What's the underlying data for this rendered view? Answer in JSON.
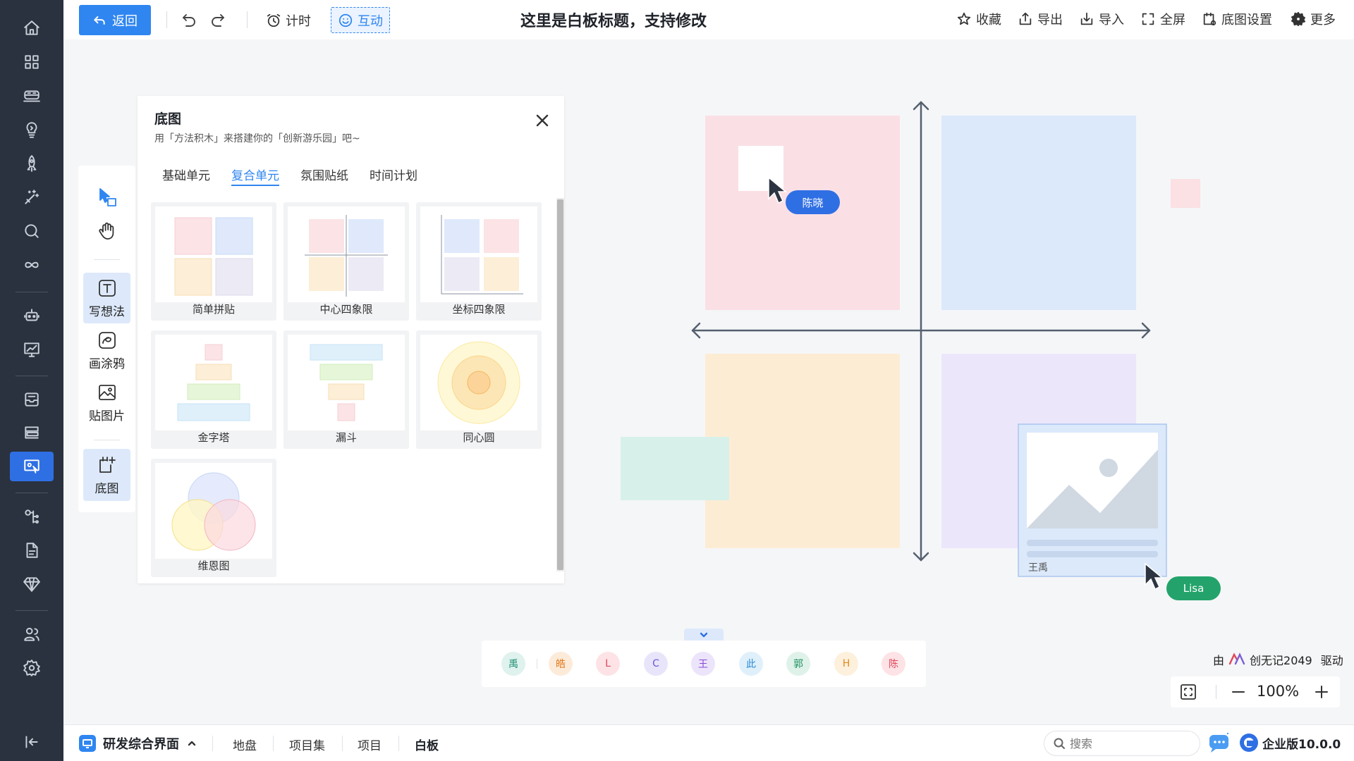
{
  "rail": {
    "items": [
      {
        "name": "home",
        "icon": "home-icon"
      },
      {
        "name": "apps",
        "icon": "grid-icon"
      },
      {
        "name": "train",
        "icon": "train-icon"
      },
      {
        "name": "idea",
        "icon": "lightbulb-icon"
      },
      {
        "name": "launch",
        "icon": "rocket-icon"
      },
      {
        "name": "magic",
        "icon": "magic-wand-icon"
      },
      {
        "name": "search",
        "icon": "search-icon"
      },
      {
        "name": "loop",
        "icon": "infinity-icon"
      },
      {
        "name": "robot",
        "icon": "robot-icon"
      },
      {
        "name": "dashboard",
        "icon": "chart-board-icon"
      },
      {
        "name": "inbox",
        "icon": "inbox-icon"
      },
      {
        "name": "layers",
        "icon": "layers-icon"
      },
      {
        "name": "whiteboard",
        "icon": "whiteboard-icon",
        "active": true
      },
      {
        "name": "mindmap",
        "icon": "mindmap-icon"
      },
      {
        "name": "document",
        "icon": "document-icon"
      },
      {
        "name": "diamond",
        "icon": "diamond-icon"
      },
      {
        "name": "members",
        "icon": "users-icon"
      },
      {
        "name": "settings",
        "icon": "gear-icon"
      },
      {
        "name": "collapse",
        "icon": "collapse-left-icon"
      }
    ]
  },
  "toolbar": {
    "back_label": "返回",
    "timer_label": "计时",
    "interact_label": "互动",
    "title": "这里是白板标题，支持修改",
    "favorite_label": "收藏",
    "export_label": "导出",
    "import_label": "导入",
    "fullscreen_label": "全屏",
    "bg_settings_label": "底图设置",
    "more_label": "更多"
  },
  "tools": {
    "write_label": "写想法",
    "draw_label": "画涂鸦",
    "image_label": "贴图片",
    "base_label": "底图"
  },
  "panel": {
    "title": "底图",
    "subtitle": "用「方法积木」来搭建你的「创新游乐园」吧~",
    "tabs": [
      "基础单元",
      "复合单元",
      "氛围贴纸",
      "时间计划"
    ],
    "active_tab": 1,
    "cards": [
      "简单拼贴",
      "中心四象限",
      "坐标四象限",
      "金字塔",
      "漏斗",
      "同心圆",
      "维恩图"
    ]
  },
  "board": {
    "cursor_chen": "陈晓",
    "cursor_lisa": "Lisa",
    "image_caption": "王禹"
  },
  "participants": [
    {
      "initial": "禹",
      "bg": "#dff2ee",
      "fg": "#1f8f72"
    },
    {
      "initial": "皓",
      "bg": "#fdebd9",
      "fg": "#e27a1f"
    },
    {
      "initial": "L",
      "bg": "#fde3e6",
      "fg": "#e0475a"
    },
    {
      "initial": "C",
      "bg": "#e8e5fb",
      "fg": "#6a57d8"
    },
    {
      "initial": "王",
      "bg": "#ece4fb",
      "fg": "#8a48d8"
    },
    {
      "initial": "此",
      "bg": "#dff0fb",
      "fg": "#2a8ad6"
    },
    {
      "initial": "郭",
      "bg": "#dff2ea",
      "fg": "#1f8f5e"
    },
    {
      "initial": "H",
      "bg": "#fdf0dc",
      "fg": "#e08a1f"
    },
    {
      "initial": "陈",
      "bg": "#fde3e6",
      "fg": "#e0475a"
    }
  ],
  "powered": {
    "prefix": "由",
    "brand": "创无记2049",
    "suffix": "驱动"
  },
  "zoom": {
    "value": "100%"
  },
  "bottombar": {
    "project": "研发综合界面",
    "nav": [
      "地盘",
      "项目集",
      "项目",
      "白板"
    ],
    "search_placeholder": "搜索",
    "edition": "企业版10.0.0"
  },
  "colors": {
    "accent": "#2f86f0",
    "rail_bg": "#2a323f",
    "cursor_blue": "#2f6fe4",
    "cursor_green": "#23a36b"
  }
}
